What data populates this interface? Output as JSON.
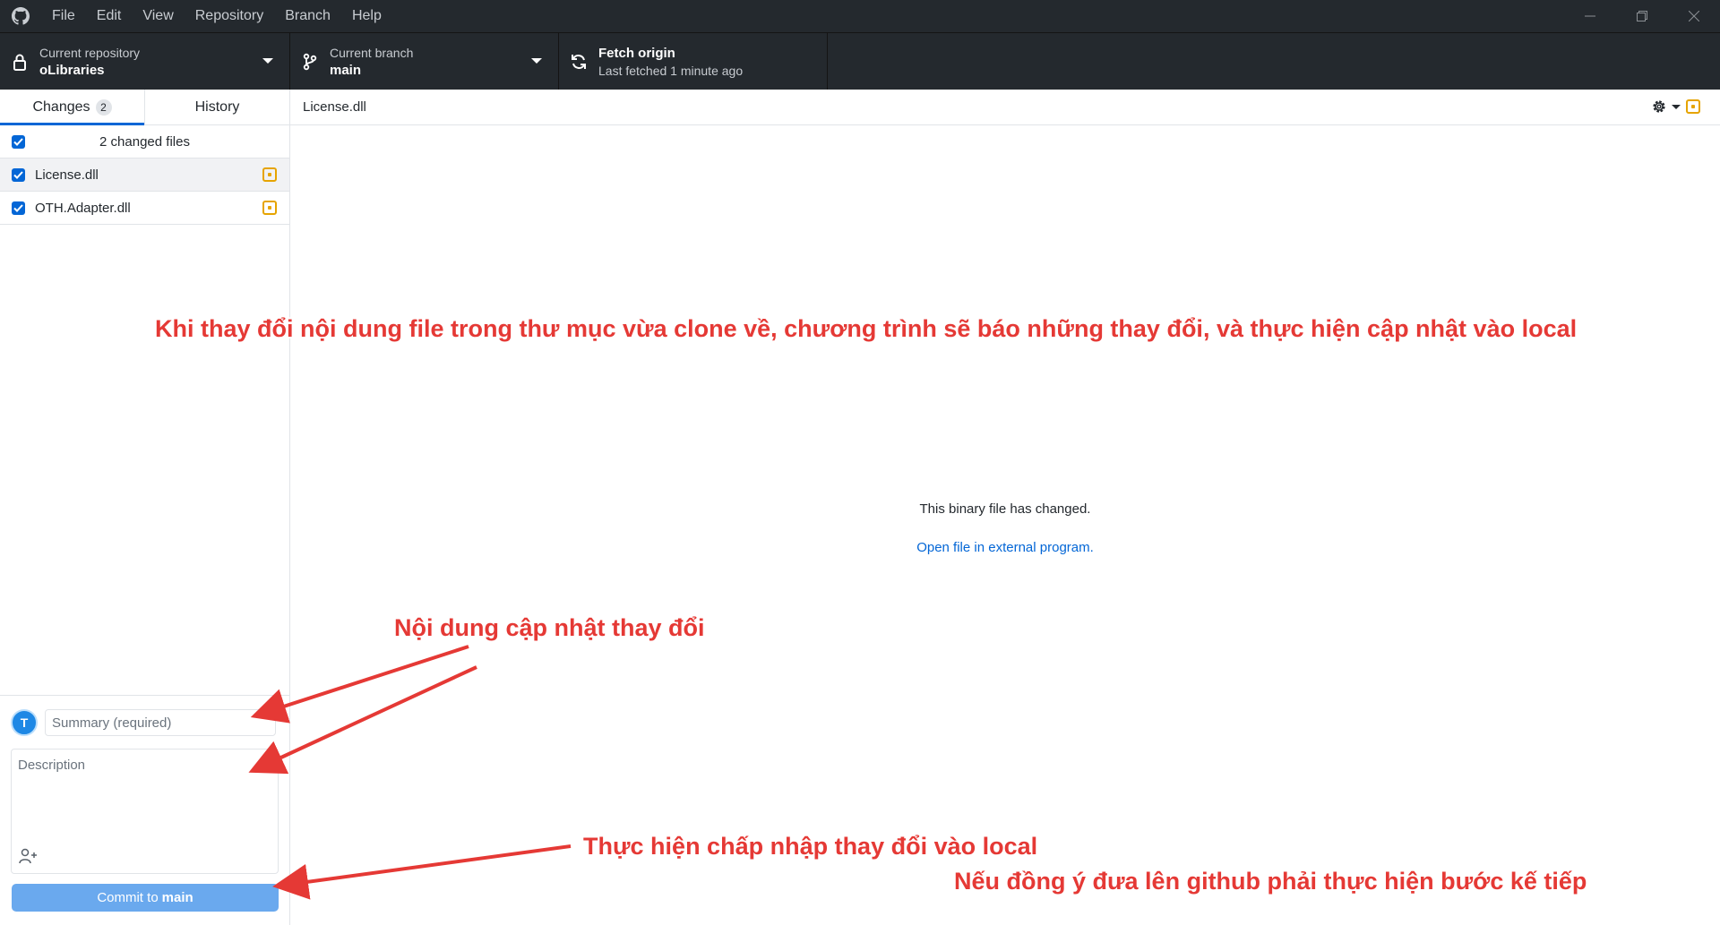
{
  "menu": {
    "items": [
      "File",
      "Edit",
      "View",
      "Repository",
      "Branch",
      "Help"
    ]
  },
  "toolbar": {
    "repo_label": "Current repository",
    "repo_value": "oLibraries",
    "branch_label": "Current branch",
    "branch_value": "main",
    "fetch_title": "Fetch origin",
    "fetch_sub": "Last fetched 1 minute ago"
  },
  "sidebar": {
    "tab_changes": "Changes",
    "changes_count": "2",
    "tab_history": "History",
    "changed_files_label": "2 changed files",
    "files": [
      {
        "name": "License.dll"
      },
      {
        "name": "OTH.Adapter.dll"
      }
    ],
    "avatar_initial": "T",
    "summary_placeholder": "Summary (required)",
    "description_placeholder": "Description",
    "commit_prefix": "Commit to",
    "commit_branch": "main"
  },
  "main": {
    "file_title": "License.dll",
    "binary_message": "This binary file has changed.",
    "open_link": "Open file in external program."
  },
  "annotations": {
    "top": "Khi thay đổi nội dung file trong thư mục vừa clone về, chương trình sẽ báo những thay đổi, và thực hiện cập nhật vào local",
    "content": "Nội dung cập nhật thay đổi",
    "commit": "Thực hiện chấp nhập thay đổi vào local",
    "next": "Nếu đồng ý đưa lên github phải thực hiện bước kế tiếp"
  },
  "colors": {
    "accent": "#0366d6",
    "toolbar_bg": "#24292e",
    "annotation_red": "#e53935",
    "modified": "#e6a400",
    "commit_button": "#6aa9ee"
  }
}
